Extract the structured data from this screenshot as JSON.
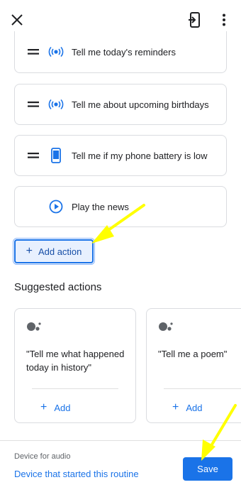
{
  "header": {
    "close_icon": "close-icon",
    "shortcut_icon": "add-to-home-screen-icon",
    "more_icon": "more-vert-icon"
  },
  "actions": [
    {
      "label": "Tell me today's reminders",
      "icon": "assistant-broadcast-icon"
    },
    {
      "label": "Tell me about upcoming birthdays",
      "icon": "assistant-broadcast-icon"
    },
    {
      "label": "Tell me if my phone battery is low",
      "icon": "phone-icon"
    },
    {
      "label": "Play the news",
      "icon": "play-circle-icon"
    }
  ],
  "add_action": {
    "label": "Add action"
  },
  "suggested": {
    "title": "Suggested actions",
    "items": [
      {
        "text": "\"Tell me what happened today in history\"",
        "add_label": "Add"
      },
      {
        "text": "\"Tell me a poem\"",
        "add_label": "Add"
      }
    ]
  },
  "footer": {
    "device_label": "Device for audio",
    "device_value": "Device that started this routine",
    "save_label": "Save"
  },
  "colors": {
    "accent": "#1a73e8",
    "annotation_arrow": "#ffff00"
  }
}
